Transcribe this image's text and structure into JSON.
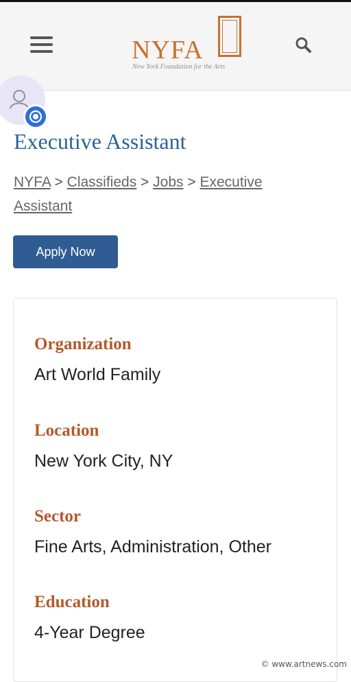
{
  "header": {
    "logo_text": "NYFA",
    "logo_tagline": "New York Foundation for the Arts",
    "menu_icon": "hamburger-menu-icon",
    "search_icon": "search-icon"
  },
  "profile": {
    "avatar_icon": "user-avatar-icon",
    "badge_icon": "chat-badge-icon"
  },
  "job": {
    "title": "Executive Assistant",
    "apply_label": "Apply Now"
  },
  "breadcrumb": {
    "items": [
      "NYFA",
      "Classifieds",
      "Jobs",
      "Executive Assistant"
    ],
    "separator": ">"
  },
  "details": [
    {
      "label": "Organization",
      "value": "Art World Family"
    },
    {
      "label": "Location",
      "value": "New York City, NY"
    },
    {
      "label": "Sector",
      "value": "Fine Arts, Administration, Other"
    },
    {
      "label": "Education",
      "value": "4-Year Degree"
    }
  ],
  "watermark": "© www.artnews.com",
  "colors": {
    "brand_orange": "#c8702e",
    "title_blue": "#2a6396",
    "button_blue": "#2f5c93",
    "label_rust": "#b35a2b"
  }
}
